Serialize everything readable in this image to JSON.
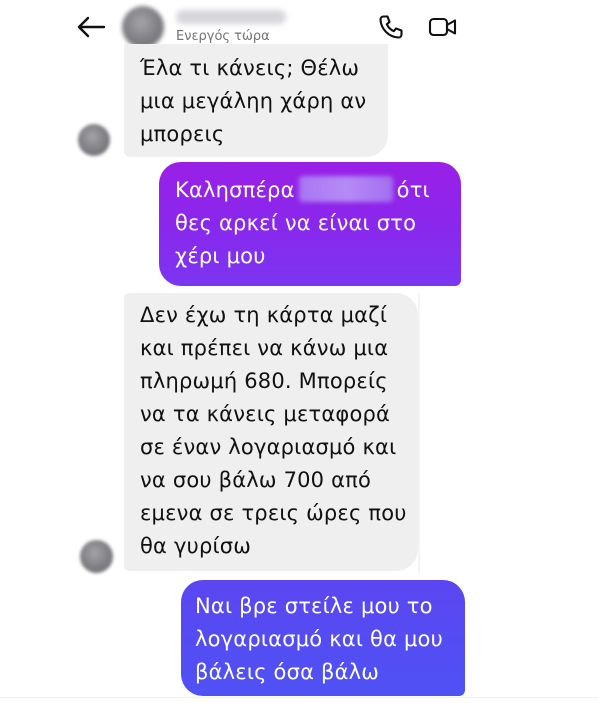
{
  "header": {
    "status": "Ενεργός τώρα",
    "icons": {
      "back": "back-arrow-icon",
      "call": "phone-icon",
      "video": "video-camera-icon"
    }
  },
  "messages": [
    {
      "direction": "incoming",
      "lines": [
        "Έλα τι κάνεις; Θέλω",
        "μια μεγάληη χάρη αν",
        "μπορεις"
      ]
    },
    {
      "direction": "outgoing",
      "lines": [
        "Καλησπέρα",
        "ότι",
        "θες αρκεί να είναι στο",
        "χέρι μου"
      ]
    },
    {
      "direction": "incoming",
      "lines": [
        "Δεν έχω τη κάρτα μαζί",
        "και πρέπει να κάνω μια",
        "πληρωμή 680. Μπορείς",
        "να τα κάνεις μεταφορά",
        "σε έναν λογαριασμό και",
        "να σου βάλω  700 από",
        "εμενα σε τρεις ώρες που",
        "θα γυρίσω"
      ]
    },
    {
      "direction": "outgoing",
      "lines": [
        "Ναι βρε στείλε μου το",
        "λογαριασμό και θα μου",
        "βάλεις όσα βάλω"
      ]
    }
  ],
  "colors": {
    "incoming_bubble": "#efefef",
    "outgoing_top": "#9a20e6",
    "outgoing_bottom": "#4e52f4",
    "status_text": "#737373"
  }
}
